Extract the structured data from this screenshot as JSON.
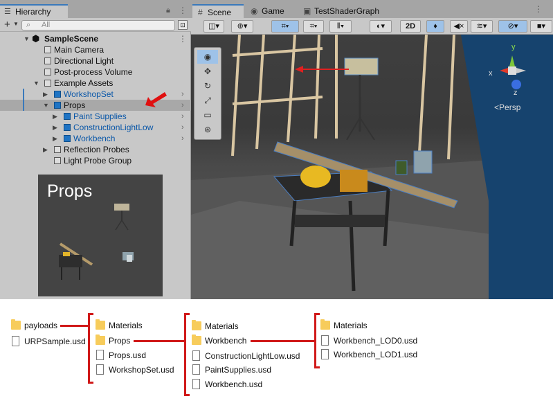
{
  "hierarchy": {
    "tab_label": "Hierarchy",
    "search_placeholder": "All",
    "rows": [
      {
        "label": "SampleScene",
        "blue": false,
        "bold": true
      },
      {
        "label": "Main Camera"
      },
      {
        "label": "Directional Light"
      },
      {
        "label": "Post-process Volume"
      },
      {
        "label": "Example Assets"
      },
      {
        "label": "WorkshopSet"
      },
      {
        "label": "Props"
      },
      {
        "label": "Paint Supplies"
      },
      {
        "label": "ConstructionLightLow"
      },
      {
        "label": "Workbench"
      },
      {
        "label": "Reflection Probes"
      },
      {
        "label": "Light Probe Group"
      }
    ],
    "preview_title": "Props"
  },
  "scene": {
    "tabs": [
      {
        "label": "Scene",
        "icon": "grid-icon"
      },
      {
        "label": "Game",
        "icon": "gamepad-icon"
      },
      {
        "label": "TestShaderGraph",
        "icon": "graph-icon"
      }
    ],
    "toolbar": {
      "mode_2d": "2D"
    },
    "gizmo": {
      "projection": "Persp",
      "axis_y": "y",
      "axis_x": "x",
      "axis_z": "z"
    }
  },
  "files": {
    "col1": [
      {
        "type": "folder",
        "name": "payloads"
      },
      {
        "type": "file",
        "name": "URPSample.usd"
      }
    ],
    "col2": [
      {
        "type": "folder",
        "name": "Materials"
      },
      {
        "type": "folder",
        "name": "Props"
      },
      {
        "type": "file",
        "name": "Props.usd"
      },
      {
        "type": "file",
        "name": "WorkshopSet.usd"
      }
    ],
    "col3": [
      {
        "type": "folder",
        "name": "Materials"
      },
      {
        "type": "folder",
        "name": "Workbench"
      },
      {
        "type": "file",
        "name": "ConstructionLightLow.usd"
      },
      {
        "type": "file",
        "name": "PaintSupplies.usd"
      },
      {
        "type": "file",
        "name": "Workbench.usd"
      }
    ],
    "col4": [
      {
        "type": "folder",
        "name": "Materials"
      },
      {
        "type": "file",
        "name": "Workbench_LOD0.usd"
      },
      {
        "type": "file",
        "name": "Workbench_LOD1.usd"
      }
    ]
  },
  "colors": {
    "accent": "#d01919",
    "selection": "#3a79bb",
    "prefab_blue": "#0a57a8"
  }
}
